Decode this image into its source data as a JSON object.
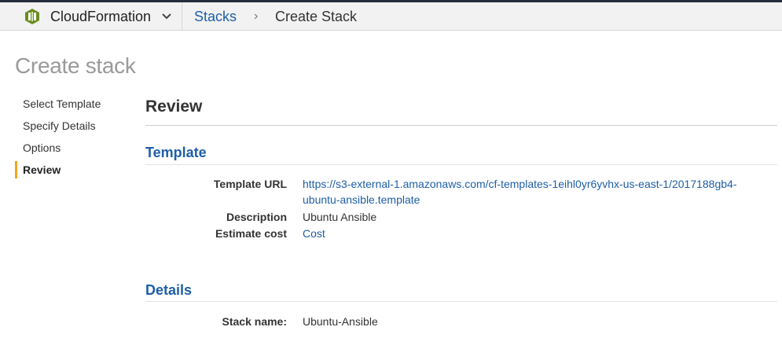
{
  "header": {
    "service_name": "CloudFormation",
    "breadcrumb_stacks": "Stacks",
    "breadcrumb_separator": "›",
    "breadcrumb_current": "Create Stack"
  },
  "page": {
    "title": "Create stack"
  },
  "steps": [
    {
      "label": "Select Template"
    },
    {
      "label": "Specify Details"
    },
    {
      "label": "Options"
    },
    {
      "label": "Review"
    }
  ],
  "main": {
    "title": "Review",
    "template_section": {
      "title": "Template",
      "url_label": "Template URL",
      "url_line1": "https://s3-external-1.amazonaws.com/cf-templates-1eihl0yr6yvhx-us-east-1/2017188gb4-",
      "url_line2": "ubuntu-ansible.template",
      "description_label": "Description",
      "description_value": "Ubuntu Ansible",
      "cost_label": "Estimate cost",
      "cost_value": "Cost"
    },
    "details_section": {
      "title": "Details",
      "stack_name_label": "Stack name:",
      "stack_name_value": "Ubuntu-Ansible"
    }
  },
  "colors": {
    "link": "#1e5fa8",
    "active_step_marker": "#f0a51e",
    "header_bg": "#f2f2f2"
  }
}
